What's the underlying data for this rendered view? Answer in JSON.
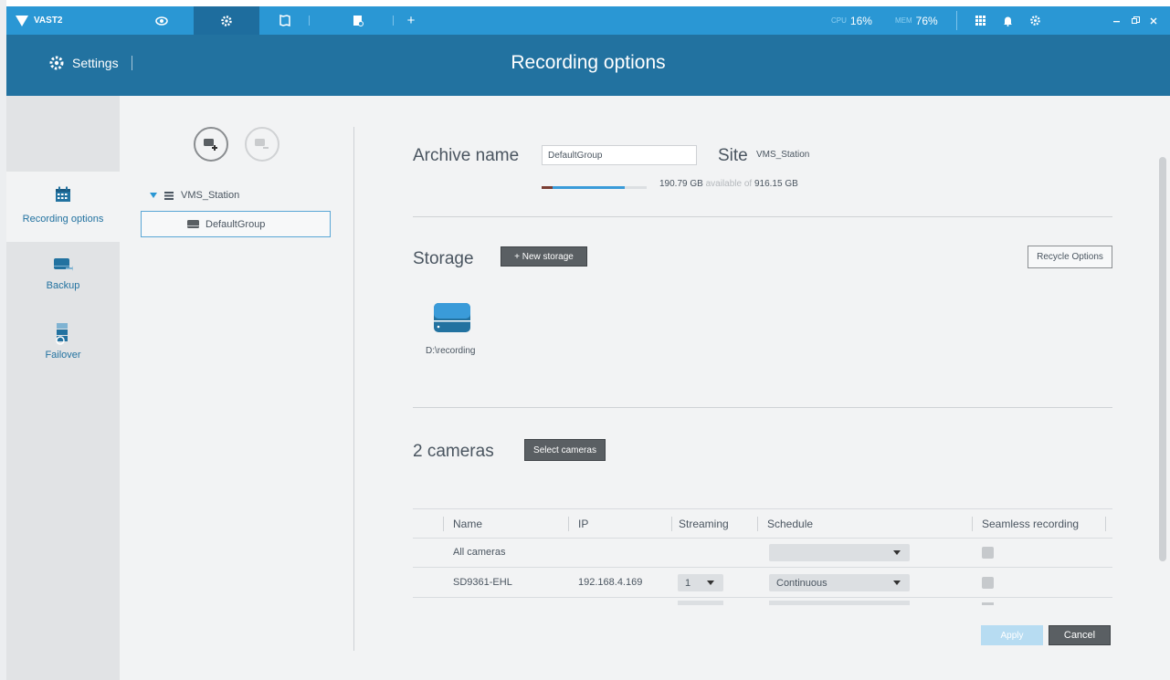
{
  "app": {
    "name": "VAST2"
  },
  "titlebar": {
    "cpu_label": "CPU",
    "cpu_value": "16%",
    "mem_label": "MEM",
    "mem_value": "76%",
    "add_tab": "+"
  },
  "header": {
    "settings_label": "Settings",
    "page_title": "Recording options"
  },
  "leftnav": {
    "items": [
      {
        "label": "Recording options",
        "icon": "calendar-icon",
        "active": true
      },
      {
        "label": "Backup",
        "icon": "backup-drive-icon",
        "active": false
      },
      {
        "label": "Failover",
        "icon": "failover-server-icon",
        "active": false
      }
    ]
  },
  "tree": {
    "root_label": "VMS_Station",
    "child_label": "DefaultGroup"
  },
  "archive": {
    "label": "Archive name",
    "value": "DefaultGroup",
    "site_label": "Site",
    "site_value": "VMS_Station",
    "available": "190.79 GB",
    "available_text": "available of",
    "total": "916.15 GB",
    "used_fraction": 0.79
  },
  "storage": {
    "label": "Storage",
    "new_button": "+ New storage",
    "recycle_button": "Recycle Options",
    "drives": [
      {
        "path": "D:\\recording"
      }
    ]
  },
  "cameras": {
    "title": "2 cameras",
    "select_button": "Select cameras",
    "columns": [
      "Name",
      "IP",
      "Streaming",
      "Schedule",
      "Seamless recording"
    ],
    "rows": [
      {
        "name": "All cameras",
        "ip": "",
        "streaming": "",
        "schedule": ""
      },
      {
        "name": "SD9361-EHL",
        "ip": "192.168.4.169",
        "streaming": "1",
        "schedule": "Continuous"
      }
    ]
  },
  "footer": {
    "apply": "Apply",
    "cancel": "Cancel"
  },
  "colors": {
    "titlebar": "#2a97d4",
    "header": "#2272a0",
    "accent": "#2272a0",
    "bar_fill": "#3a9bd9",
    "bar_used": "#7a3d33"
  }
}
